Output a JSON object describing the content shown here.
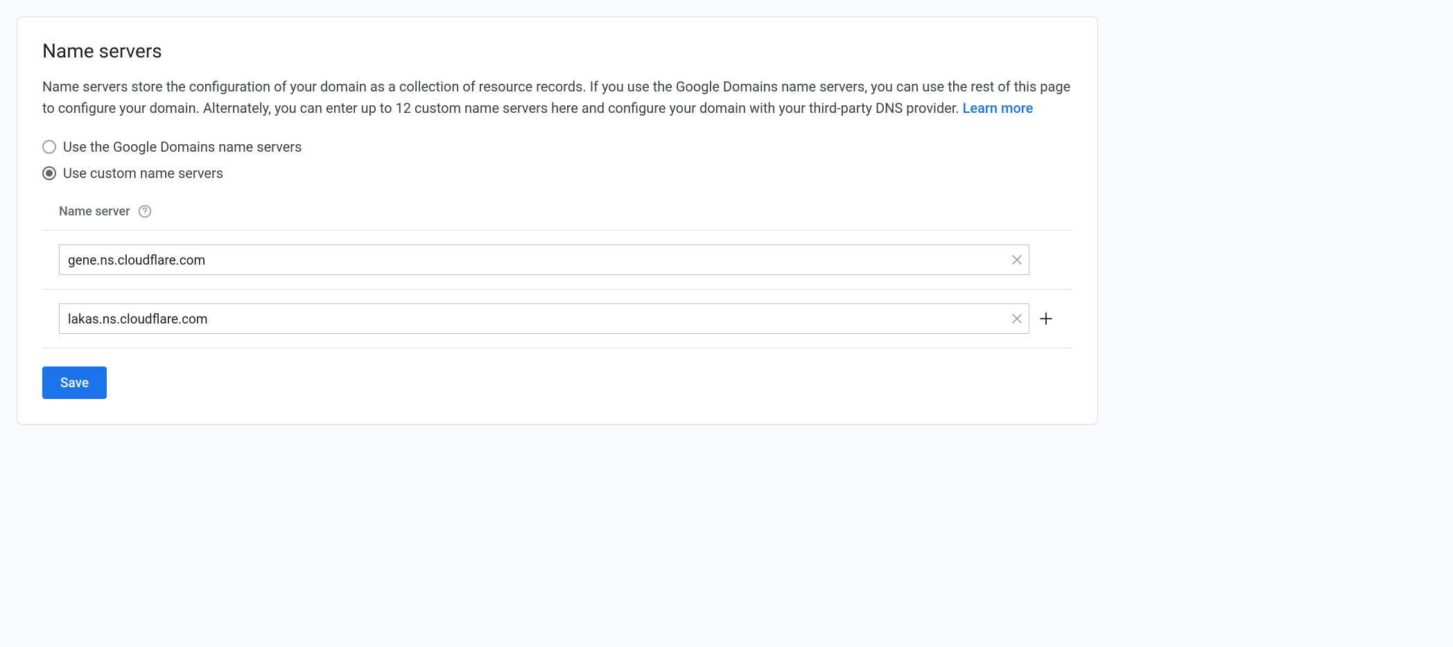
{
  "card": {
    "title": "Name servers",
    "description": "Name servers store the configuration of your domain as a collection of resource records. If you use the Google Domains name servers, you can use the rest of this page to configure your domain. Alternately, you can enter up to 12 custom name servers here and configure your domain with your third-party DNS provider. ",
    "learn_more": "Learn more"
  },
  "radios": {
    "google": {
      "label": "Use the Google Domains name servers",
      "checked": false
    },
    "custom": {
      "label": "Use custom name servers",
      "checked": true
    }
  },
  "section": {
    "header": "Name server"
  },
  "name_servers": [
    {
      "value": "gene.ns.cloudflare.com",
      "show_add": false
    },
    {
      "value": "lakas.ns.cloudflare.com",
      "show_add": true
    }
  ],
  "buttons": {
    "save": "Save"
  }
}
